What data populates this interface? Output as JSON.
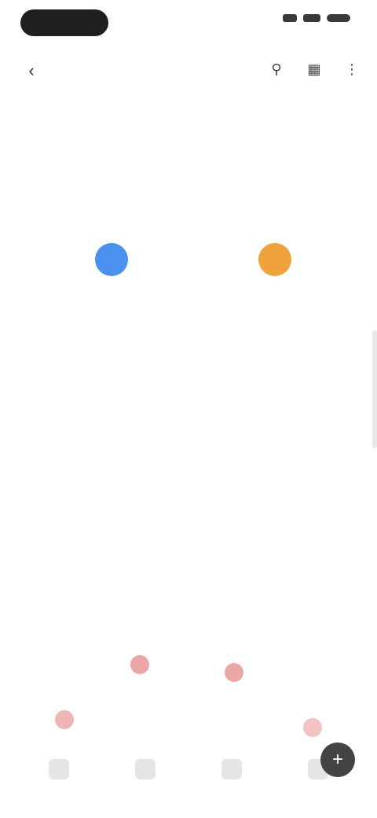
{
  "status": {
    "time": ""
  },
  "app_bar": {
    "title": ""
  },
  "tabs": [
    {
      "label": ""
    },
    {
      "label": ""
    },
    {
      "label": ""
    }
  ],
  "calendar": {
    "month_title": "",
    "weekdays": [
      "",
      "",
      "",
      "",
      "",
      "",
      ""
    ],
    "rows": [
      [
        {
          "d": "",
          "s": "muted"
        },
        {
          "d": "",
          "s": "muted"
        },
        {
          "d": "",
          "s": "selected"
        },
        {
          "d": "",
          "s": ""
        },
        {
          "d": "",
          "s": ""
        },
        {
          "d": "",
          "s": ""
        },
        {
          "d": "",
          "s": "highlight"
        }
      ],
      [
        {
          "d": "",
          "s": ""
        },
        {
          "d": "",
          "s": ""
        },
        {
          "d": "",
          "s": ""
        },
        {
          "d": "",
          "s": ""
        },
        {
          "d": "",
          "s": ""
        },
        {
          "d": "",
          "s": ""
        },
        {
          "d": "",
          "s": ""
        }
      ],
      [
        {
          "d": "",
          "s": ""
        },
        {
          "d": "",
          "s": ""
        },
        {
          "d": "",
          "s": ""
        },
        {
          "d": "",
          "s": ""
        },
        {
          "d": "",
          "s": ""
        },
        {
          "d": "",
          "s": ""
        },
        {
          "d": "",
          "s": ""
        }
      ],
      [
        {
          "d": "",
          "s": ""
        },
        {
          "d": "",
          "s": ""
        },
        {
          "d": "",
          "s": ""
        },
        {
          "d": "",
          "s": ""
        },
        {
          "d": "",
          "s": ""
        },
        {
          "d": "",
          "s": ""
        },
        {
          "d": "",
          "s": ""
        }
      ],
      [
        {
          "d": "",
          "s": ""
        },
        {
          "d": "",
          "s": ""
        },
        {
          "d": "",
          "s": ""
        },
        {
          "d": "",
          "s": "muted"
        },
        {
          "d": "",
          "s": "muted"
        },
        {
          "d": "",
          "s": "muted"
        },
        {
          "d": "",
          "s": "muted"
        }
      ]
    ]
  },
  "info": {
    "label": "",
    "value": ""
  },
  "section": {
    "title": "",
    "subtitle": ""
  },
  "nav": [
    {
      "label": ""
    },
    {
      "label": ""
    },
    {
      "label": ""
    },
    {
      "label": ""
    }
  ],
  "colors": {
    "selected": "#4a90f0",
    "highlight": "#f0a33a",
    "accent_marker": "#e06a6a"
  }
}
